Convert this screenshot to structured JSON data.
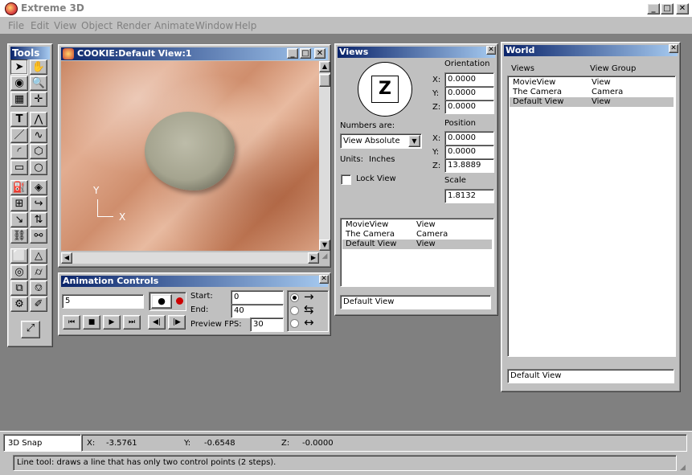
{
  "app": {
    "title": "Extreme 3D"
  },
  "menu": [
    "File",
    "Edit",
    "View",
    "Object",
    "Render",
    "Animate",
    "Window",
    "Help"
  ],
  "tools": {
    "title": "Tools"
  },
  "view_window": {
    "title": "COOKIE:Default View:1",
    "axis_y": "Y",
    "axis_x": "X"
  },
  "animation": {
    "title": "Animation Controls",
    "frame_value": "5",
    "start_label": "Start:",
    "start_value": "0",
    "end_label": "End:",
    "end_value": "40",
    "fps_label": "Preview FPS:",
    "fps_value": "30",
    "arrows": [
      "→",
      "⇆",
      "↔"
    ]
  },
  "views": {
    "title": "Views",
    "orientation_label": "Orientation",
    "orientation": {
      "x": "0.0000",
      "y": "0.0000",
      "z": "0.0000"
    },
    "position_label": "Position",
    "position": {
      "x": "0.0000",
      "y": "0.0000",
      "z": "13.8889"
    },
    "scale_label": "Scale",
    "scale": "1.8132",
    "numbers_label": "Numbers are:",
    "numbers_value": "View Absolute",
    "units_label": "Units:",
    "units_value": "Inches",
    "lock_label": "Lock View",
    "list": [
      {
        "name": "MovieView",
        "group": "View"
      },
      {
        "name": "The Camera",
        "group": "Camera"
      },
      {
        "name": "Default View",
        "group": "View"
      }
    ],
    "field_value": "Default View"
  },
  "world": {
    "title": "World",
    "col_views": "Views",
    "col_group": "View Group",
    "list": [
      {
        "name": "MovieView",
        "group": "View"
      },
      {
        "name": "The Camera",
        "group": "Camera"
      },
      {
        "name": "Default View",
        "group": "View"
      }
    ],
    "field_value": "Default View"
  },
  "status": {
    "snap": "3D Snap",
    "x_label": "X:",
    "x_value": "-3.5761",
    "y_label": "Y:",
    "y_value": "-0.6548",
    "z_label": "Z:",
    "z_value": "-0.0000",
    "hint": "Line tool: draws a line that has only two control points (2 steps)."
  }
}
